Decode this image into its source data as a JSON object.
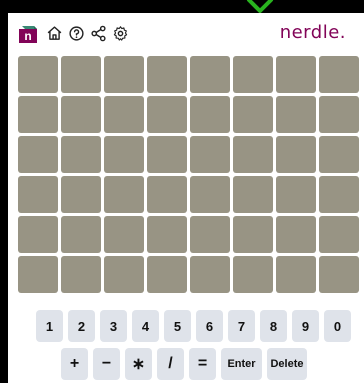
{
  "header": {
    "brand": "nerdle.",
    "logo_letter": "n",
    "icons": [
      "home-icon",
      "help-icon",
      "share-icon",
      "settings-icon"
    ]
  },
  "colors": {
    "tile": "#989484",
    "key": "#dfe3ea",
    "brand": "#820458",
    "logo_purple": "#820458",
    "logo_teal": "#398874",
    "accent_green": "#29b31f"
  },
  "board": {
    "rows": 6,
    "columns": 8,
    "guesses": []
  },
  "keyboard": {
    "numbers": [
      "1",
      "2",
      "3",
      "4",
      "5",
      "6",
      "7",
      "8",
      "9",
      "0"
    ],
    "operators": [
      "+",
      "−",
      "∗",
      "/",
      "="
    ],
    "enter_label": "Enter",
    "delete_label": "Delete"
  }
}
